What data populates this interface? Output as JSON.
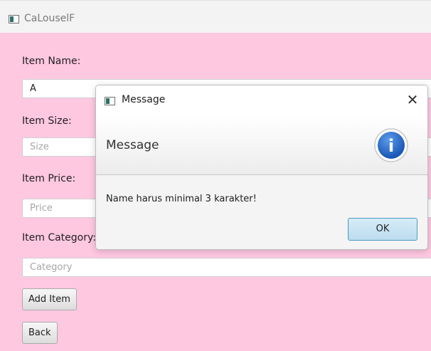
{
  "window": {
    "title": "CaLouselF"
  },
  "form": {
    "name_label": "Item Name:",
    "name_value": "A",
    "size_label": "Item Size:",
    "size_placeholder": "Size",
    "price_label": "Item Price:",
    "price_placeholder": "Price",
    "category_label": "Item Category:",
    "category_placeholder": "Category",
    "add_button": "Add Item",
    "back_button": "Back"
  },
  "dialog": {
    "title": "Message",
    "close_glyph": "✕",
    "header_text": "Message",
    "body_text": "Name harus minimal 3 karakter!",
    "ok_button": "OK",
    "icon": "info-icon",
    "icon_glyph": "i"
  },
  "colors": {
    "background": "#ffc8e1",
    "info_icon": "#1c64c6",
    "ok_border": "#4e9ac2"
  }
}
